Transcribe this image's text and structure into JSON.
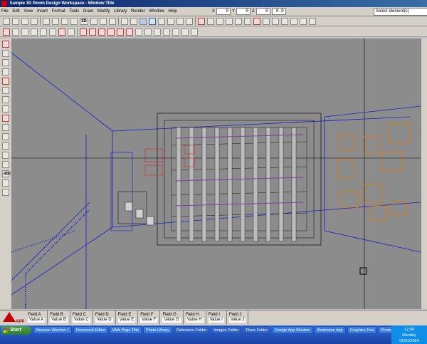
{
  "window": {
    "title": "Sample 3D Room Design Workspace - Window Title"
  },
  "menu": [
    "File",
    "Edit",
    "View",
    "Insert",
    "Format",
    "Tools",
    "Draw",
    "Modify",
    "Library",
    "Render",
    "Window",
    "Help"
  ],
  "coordinates": {
    "x_label": "X",
    "x": "0",
    "y_label": "Y",
    "y": "0",
    "z_label": "Z",
    "z": "0",
    "angle": "0.0"
  },
  "select_element": "Select element(s)",
  "statusbar": {
    "logo": "APP",
    "cells": [
      {
        "label": "Field A",
        "value": "Value A"
      },
      {
        "label": "Field B",
        "value": "Value B"
      },
      {
        "label": "Field C",
        "value": "Value C"
      },
      {
        "label": "Field D",
        "value": "Value D"
      },
      {
        "label": "Field E",
        "value": "Value E"
      },
      {
        "label": "Field F",
        "value": "Value F"
      },
      {
        "label": "Field G",
        "value": "Value G"
      },
      {
        "label": "Field H",
        "value": "Value H"
      },
      {
        "label": "Field I",
        "value": "Value I"
      },
      {
        "label": "Field J",
        "value": "Value J"
      }
    ]
  },
  "taskbar": {
    "start": "Start",
    "tasks": [
      "Browser Window 1",
      "Document Editor",
      "Web Page Title",
      "Photo Library",
      "Reference Folder",
      "Images Folder",
      "Plans Folder",
      "Design App Window",
      "Illustration App",
      "Graphics Tool",
      "Photo Editor"
    ],
    "clock": "12:00",
    "day": "Monday",
    "date": "01/01/2024"
  },
  "colors": {
    "wire_blue": "#1c1cc8",
    "wire_dark": "#1a1a1a",
    "wire_red": "#d03030",
    "wire_orange": "#e07a10",
    "viewport_bg": "#8c8c8c"
  }
}
